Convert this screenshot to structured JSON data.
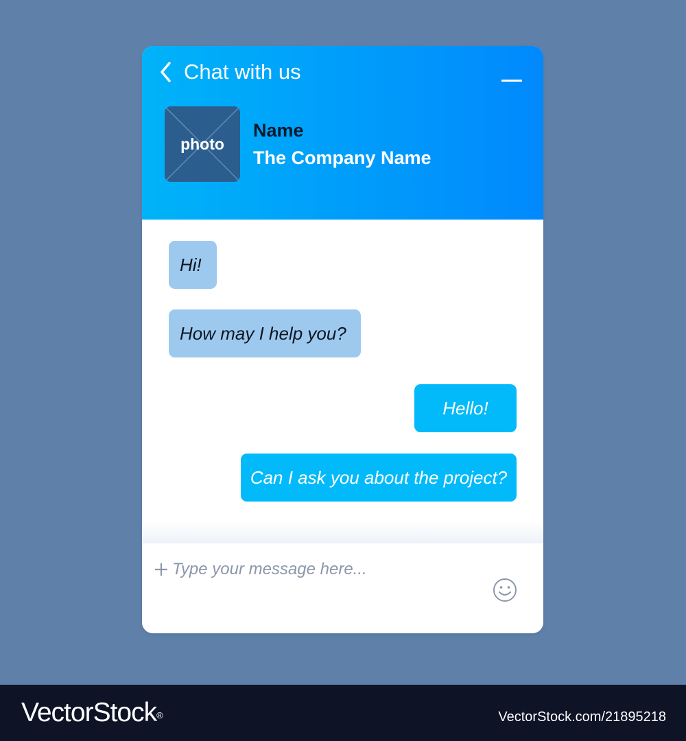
{
  "colors": {
    "page_background": "#5f80a8",
    "header_gradient_start": "#00b3f8",
    "header_gradient_end": "#0189fd",
    "incoming_bubble": "#9ec9ef",
    "outgoing_bubble": "#02baf9",
    "avatar_placeholder": "#2b5e8e",
    "footer_bar": "#0e1426"
  },
  "header": {
    "back_icon": "chevron-left-icon",
    "title": "Chat with us",
    "minimize_icon": "minimize-icon"
  },
  "contact": {
    "avatar_label": "photo",
    "name": "Name",
    "company": "The Company Name"
  },
  "messages": [
    {
      "sender": "agent",
      "text": "Hi!"
    },
    {
      "sender": "agent",
      "text": "How may I help you?"
    },
    {
      "sender": "user",
      "text": "Hello!"
    },
    {
      "sender": "user",
      "text": "Can I ask you about the project?"
    }
  ],
  "composer": {
    "attach_icon": "plus-icon",
    "placeholder": "Type your message here...",
    "value": "",
    "emoji_icon": "smiley-icon"
  },
  "footer": {
    "brand_name": "VectorStock",
    "registered_mark": "®",
    "image_id": "VectorStock.com/21895218"
  }
}
